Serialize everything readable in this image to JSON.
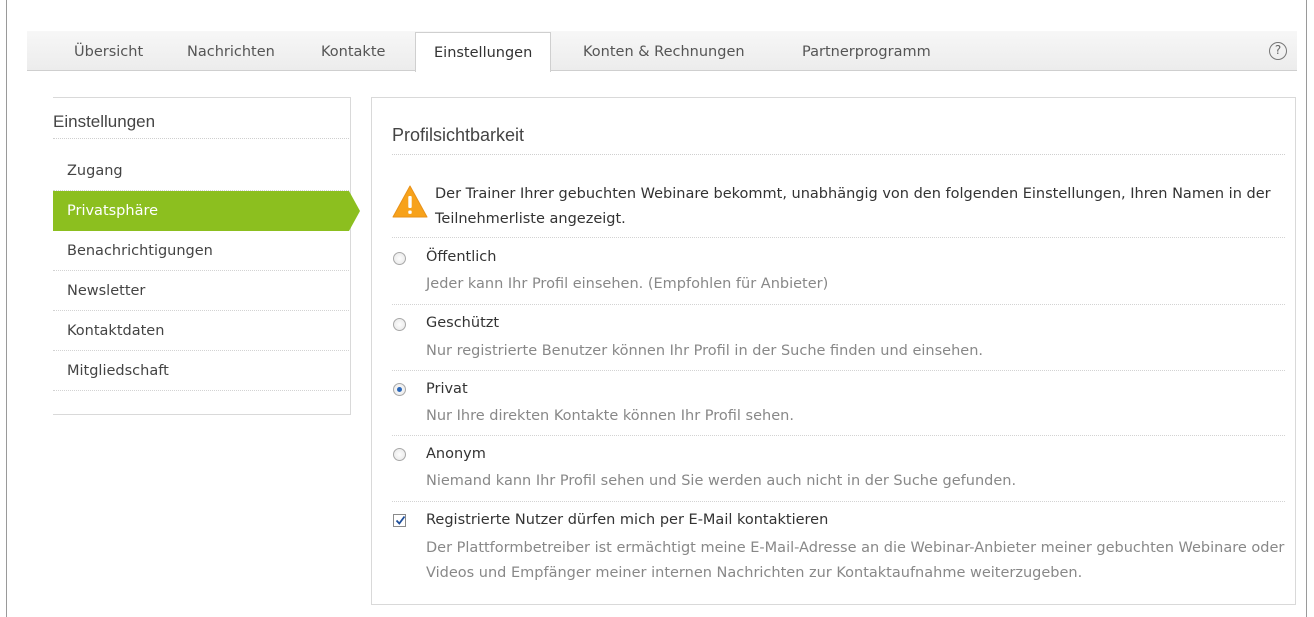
{
  "tabs": [
    {
      "label": "Übersicht"
    },
    {
      "label": "Nachrichten"
    },
    {
      "label": "Kontakte"
    },
    {
      "label": "Einstellungen"
    },
    {
      "label": "Konten & Rechnungen"
    },
    {
      "label": "Partnerprogramm"
    }
  ],
  "active_tab": "Einstellungen",
  "help": {
    "glyph": "?"
  },
  "sidebar": {
    "title": "Einstellungen",
    "items": [
      {
        "label": "Zugang"
      },
      {
        "label": "Privatsphäre"
      },
      {
        "label": "Benachrichtigungen"
      },
      {
        "label": "Newsletter"
      },
      {
        "label": "Kontaktdaten"
      },
      {
        "label": "Mitgliedschaft"
      }
    ],
    "active_item": "Privatsphäre"
  },
  "panel": {
    "title": "Profilsichtbarkeit",
    "warning": {
      "icon": "warning-icon",
      "text": "Der Trainer Ihrer gebuchten Webinare bekommt, unabhängig von den folgenden Einstellungen, Ihren Namen in der Teilnehmerliste angezeigt."
    },
    "options": [
      {
        "label": "Öffentlich",
        "description": "Jeder kann Ihr Profil einsehen. (Empfohlen für Anbieter)",
        "selected": false
      },
      {
        "label": "Geschützt",
        "description": "Nur registrierte Benutzer können Ihr Profil in der Suche finden und einsehen.",
        "selected": false
      },
      {
        "label": "Privat",
        "description": "Nur Ihre direkten Kontakte können Ihr Profil sehen.",
        "selected": true
      },
      {
        "label": "Anonym",
        "description": "Niemand kann Ihr Profil sehen und Sie werden auch nicht in der Suche gefunden.",
        "selected": false
      }
    ],
    "email_contact": {
      "label": "Registrierte Nutzer dürfen mich per E-Mail kontaktieren",
      "checked": true,
      "description": "Der Plattformbetreiber ist ermächtigt meine E-Mail-Adresse an die Webinar-Anbieter meiner gebuchten Webinare oder Videos und Empfänger meiner internen Nachrichten zur Kontaktaufnahme weiterzugeben."
    }
  },
  "colors": {
    "accent_green": "#8cbf1f",
    "warning_orange": "#f7a21b",
    "radio_selected": "#2b67b8"
  }
}
